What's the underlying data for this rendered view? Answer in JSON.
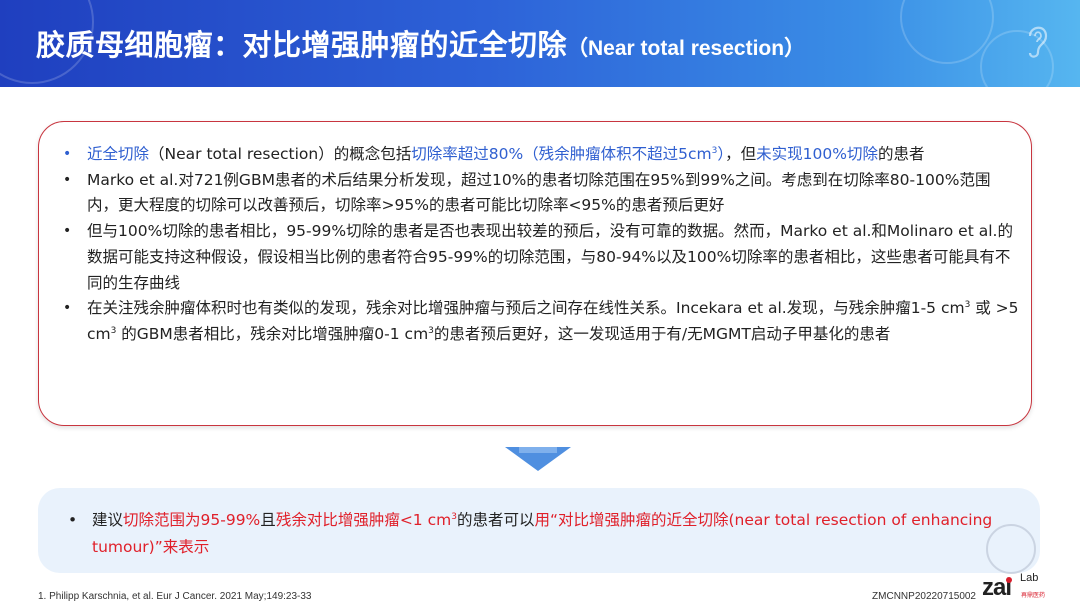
{
  "header": {
    "title_cn": "胶质母细胞瘤：对比增强肿瘤的近全切除",
    "title_en": "（Near total resection）"
  },
  "bullets": [
    {
      "segments": [
        {
          "text": "近全切除",
          "color": "blue"
        },
        {
          "text": "（Near total resection）的概念包括",
          "color": "normal"
        },
        {
          "text": "切除率超过80%（残余肿瘤体积不超过5cm",
          "color": "blue"
        },
        {
          "text": "3",
          "color": "blue",
          "sup": true
        },
        {
          "text": "）",
          "color": "blue"
        },
        {
          "text": "，但",
          "color": "normal"
        },
        {
          "text": "未实现100%切除",
          "color": "blue"
        },
        {
          "text": "的患者",
          "color": "normal"
        }
      ],
      "bullet_color": "blue"
    },
    {
      "segments": [
        {
          "text": "Marko et al.对721例GBM患者的术后结果分析发现，超过10%的患者切除范围在95%到99%之间。考虑到在切除率80-100%范围内，更大程度的切除可以改善预后，切除率>95%的患者可能比切除率<95%的患者预后更好",
          "color": "normal"
        }
      ]
    },
    {
      "segments": [
        {
          "text": "但与100%切除的患者相比，95-99%切除的患者是否也表现出较差的预后，没有可靠的数据。然而，Marko et al.和Molinaro et al.的数据可能支持这种假设，假设相当比例的患者符合95-99%的切除范围，与80-94%以及100%切除率的患者相比，这些患者可能具有不同的生存曲线",
          "color": "normal"
        }
      ]
    },
    {
      "segments": [
        {
          "text": "在关注残余肿瘤体积时也有类似的发现，残余对比增强肿瘤与预后之间存在线性关系。Incekara et al.发现，与残余肿瘤1-5 cm",
          "color": "normal"
        },
        {
          "text": "3",
          "color": "normal",
          "sup": true
        },
        {
          "text": " 或 >5 cm",
          "color": "normal"
        },
        {
          "text": "3",
          "color": "normal",
          "sup": true
        },
        {
          "text": " 的GBM患者相比，残余对比增强肿瘤0-1 cm",
          "color": "normal"
        },
        {
          "text": "3",
          "color": "normal",
          "sup": true
        },
        {
          "text": "的患者预后更好，这一发现适用于有/无MGMT启动子甲基化的患者",
          "color": "normal"
        }
      ]
    }
  ],
  "conclusion": {
    "segments": [
      {
        "text": "建议",
        "color": "normal"
      },
      {
        "text": "切除范围为95-99%",
        "color": "red"
      },
      {
        "text": "且",
        "color": "normal"
      },
      {
        "text": "残余对比增强肿瘤<1 cm",
        "color": "red"
      },
      {
        "text": "3",
        "color": "red",
        "sup": true
      },
      {
        "text": "的患者可以",
        "color": "normal"
      },
      {
        "text": "用“对比增强肿瘤的近全切除(near total resection of enhancing tumour)”来表示",
        "color": "red"
      }
    ]
  },
  "footnote": "1.   Philipp Karschnia, et al. Eur J Cancer. 2021 May;149:23-33",
  "doc_code": "ZMCNNP20220715002",
  "logo": {
    "main": "zai",
    "sup": "Lab",
    "sub": "再鼎医药"
  },
  "colors": {
    "header_start": "#1f3fbf",
    "header_end": "#56b6f0",
    "blue": "#2f5fd0",
    "red": "#e0202a",
    "box_border": "#c8353f",
    "arrow": "#4f8fe0",
    "bottom_bg": "#e9f2fc"
  },
  "icons": {
    "header_right": "ear-icon",
    "divider": "arrow-down-icon"
  }
}
